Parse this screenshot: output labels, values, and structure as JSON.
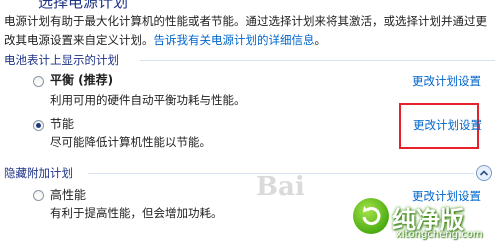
{
  "page_title": "选择电源计划",
  "intro": {
    "text": "电源计划有助于最大化计算机的性能或者节能。通过选择计划来将其激活，或选择计划并通过更改其电源设置来自定义计划。",
    "link": "告诉我有关电源计划的详细信息",
    "suffix": "。"
  },
  "battery_group": {
    "label": "电池表计上显示的计划",
    "plans": [
      {
        "name": "平衡 (推荐)",
        "desc": "利用可用的硬件自动平衡功耗与性能。",
        "link": "更改计划设置",
        "selected": false
      },
      {
        "name": "节能",
        "desc": "尽可能降低计算机性能以节能。",
        "link": "更改计划设置",
        "selected": true
      }
    ]
  },
  "hidden_group": {
    "label": "隐藏附加计划",
    "expander_icon": "chevron-up-icon",
    "plans": [
      {
        "name": "高性能",
        "desc": "有利于提高性能，但会增加功耗。",
        "link": "更改计划设置",
        "selected": false
      }
    ]
  },
  "annotation": {
    "color": "#e8202a"
  },
  "watermark": {
    "logo_icon": "refresh-leaf-icon",
    "brand": "纯净版",
    "domain": "xitongcheng.com",
    "faint": "Bai"
  }
}
